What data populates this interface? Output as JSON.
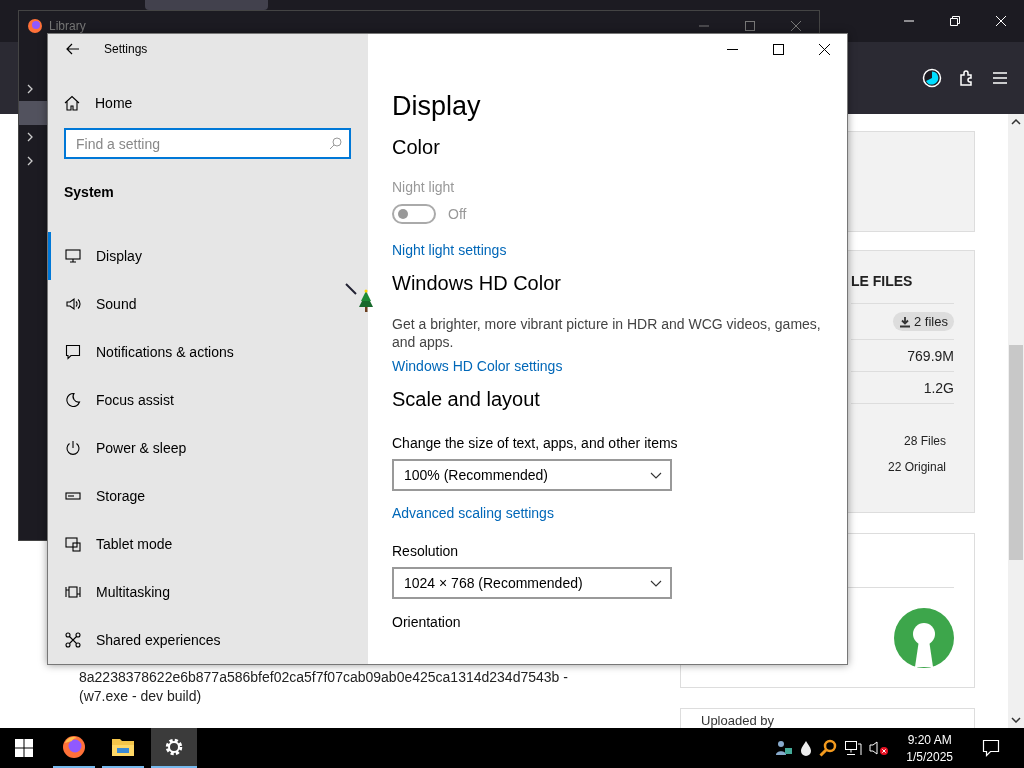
{
  "library_window": {
    "title": "Library",
    "tree_rows": [
      {
        "selected": false
      },
      {
        "selected": true
      },
      {
        "selected": false
      },
      {
        "selected": false
      }
    ]
  },
  "page": {
    "card_heading": "LE FILES",
    "files_badge": "2 files",
    "sizes": [
      "769.9M",
      "1.2G"
    ],
    "counts": [
      "28 Files",
      "22 Original"
    ],
    "hash_lines": [
      "8a2238378622e6b877a586bfef02ca5f7f07cab09ab0e425ca1314d234d7543b -",
      "(w7.exe - dev build)"
    ],
    "uploaded_by": "Uploaded by"
  },
  "settings": {
    "title": "Settings",
    "home": "Home",
    "search": {
      "placeholder": "Find a setting"
    },
    "group": "System",
    "nav": [
      {
        "kind": "display",
        "label": "Display",
        "selected": true
      },
      {
        "kind": "sound",
        "label": "Sound",
        "selected": false
      },
      {
        "kind": "notifications",
        "label": "Notifications & actions",
        "selected": false
      },
      {
        "kind": "focus",
        "label": "Focus assist",
        "selected": false
      },
      {
        "kind": "power",
        "label": "Power & sleep",
        "selected": false
      },
      {
        "kind": "storage",
        "label": "Storage",
        "selected": false
      },
      {
        "kind": "tablet",
        "label": "Tablet mode",
        "selected": false
      },
      {
        "kind": "multitasking",
        "label": "Multitasking",
        "selected": false
      },
      {
        "kind": "shared",
        "label": "Shared experiences",
        "selected": false
      }
    ],
    "page_title": "Display",
    "content": [
      {
        "kind": "heading",
        "text": "Color"
      },
      {
        "kind": "toggle",
        "label": "Night light",
        "disabled": true,
        "on": false,
        "state_text": "Off"
      },
      {
        "kind": "link",
        "text": "Night light settings"
      },
      {
        "kind": "heading",
        "text": "Windows HD Color"
      },
      {
        "kind": "text",
        "text": "Get a brighter, more vibrant picture in HDR and WCG videos, games, and apps."
      },
      {
        "kind": "link",
        "text": "Windows HD Color settings"
      },
      {
        "kind": "heading",
        "text": "Scale and layout"
      },
      {
        "kind": "label",
        "text": "Change the size of text, apps, and other items"
      },
      {
        "kind": "dropdown",
        "value": "100% (Recommended)"
      },
      {
        "kind": "link",
        "text": "Advanced scaling settings"
      },
      {
        "kind": "label",
        "text": "Resolution"
      },
      {
        "kind": "dropdown",
        "value": "1024 × 768 (Recommended)"
      },
      {
        "kind": "label",
        "text": "Orientation"
      }
    ]
  },
  "taskbar": {
    "apps": [
      {
        "kind": "firefox",
        "active": false
      },
      {
        "kind": "explorer",
        "active": false
      },
      {
        "kind": "settings",
        "active": true
      }
    ],
    "time": "9:20 AM",
    "date": "1/5/2025"
  }
}
